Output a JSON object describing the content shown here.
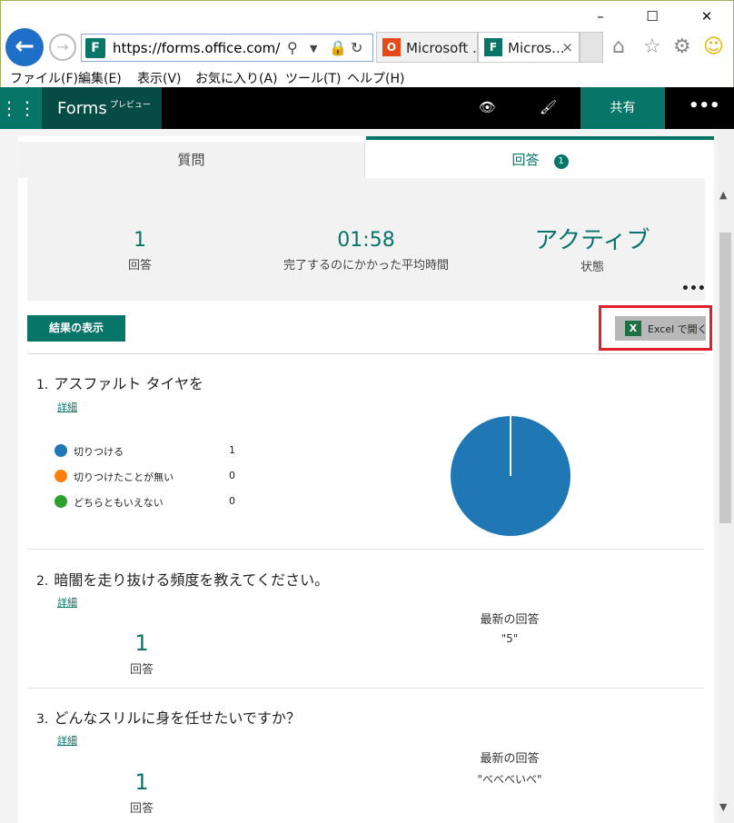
{
  "browser": {
    "url": "https://forms.office.com/Pa",
    "tabs": [
      {
        "icon": "office",
        "title": "Microsoft ..."
      },
      {
        "icon": "forms",
        "title": "Micros...",
        "close": "×"
      }
    ],
    "menu": [
      "ファイル(F)",
      "編集(E)",
      "表示(V)",
      "お気に入り(A)",
      "ツール(T)",
      "ヘルプ(H)"
    ],
    "window_controls": {
      "minimize": "–",
      "maximize": "☐",
      "close": "✕"
    }
  },
  "app": {
    "name": "Forms",
    "badge": "プレビュー",
    "share_label": "共有",
    "more_label": "•••"
  },
  "tabs": {
    "questions": "質問",
    "responses": "回答",
    "responses_count": "1"
  },
  "summary": {
    "responses_value": "1",
    "responses_label": "回答",
    "avg_time_value": "01:58",
    "avg_time_label": "完了するのにかかった平均時間",
    "status_value": "アクティブ",
    "status_label": "状態",
    "more": "•••"
  },
  "actions": {
    "view_results": "結果の表示",
    "open_excel": "Excel で開く"
  },
  "colors": {
    "accent": "#077568",
    "highlight": "#e0202a",
    "series_blue": "#1f77b4",
    "series_orange": "#ff7f0e",
    "series_green": "#2ca02c"
  },
  "questions": [
    {
      "number": "1.",
      "title": "アスファルト タイヤを",
      "detail": "詳細",
      "options": [
        {
          "label": "切りつける",
          "count": "1"
        },
        {
          "label": "切りつけたことが無い",
          "count": "0"
        },
        {
          "label": "どちらともいえない",
          "count": "0"
        }
      ]
    },
    {
      "number": "2.",
      "title": "暗闇を走り抜ける頻度を教えてください。",
      "detail": "詳細",
      "count_value": "1",
      "count_label": "回答",
      "latest_label": "最新の回答",
      "latest_value": "\"5\""
    },
    {
      "number": "3.",
      "title": "どんなスリルに身を任せたいですか？",
      "detail": "詳細",
      "count_value": "1",
      "count_label": "回答",
      "latest_label": "最新の回答",
      "latest_value": "\"べべべいべ\""
    }
  ],
  "chart_data": {
    "type": "pie",
    "categories": [
      "切りつける",
      "切りつけたことが無い",
      "どちらともいえない"
    ],
    "values": [
      1,
      0,
      0
    ],
    "title": "",
    "legend": "left"
  }
}
